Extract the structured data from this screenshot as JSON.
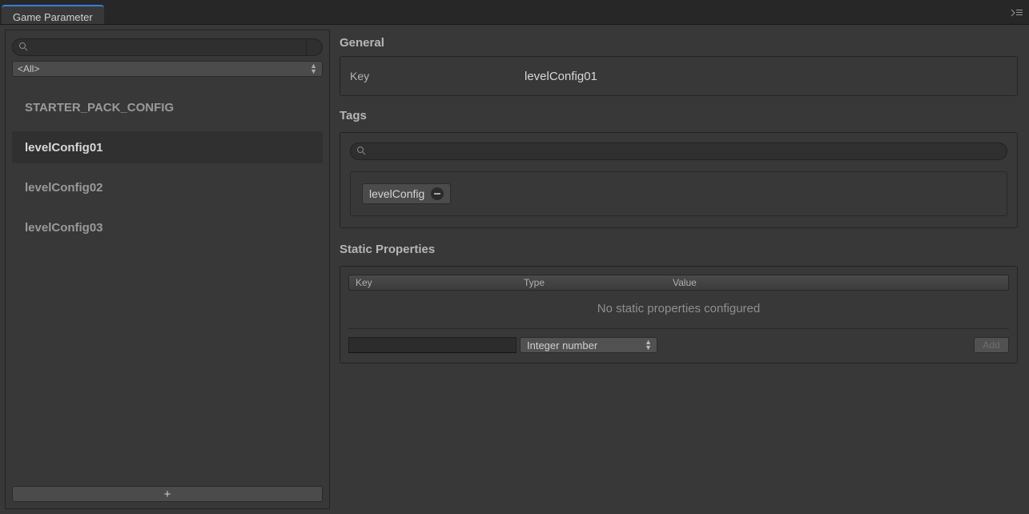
{
  "tab": {
    "title": "Game Parameter"
  },
  "sidebar": {
    "search": {
      "placeholder": ""
    },
    "filter": {
      "label": "<All>"
    },
    "items": [
      {
        "label": "STARTER_PACK_CONFIG",
        "selected": false
      },
      {
        "label": "levelConfig01",
        "selected": true
      },
      {
        "label": "levelConfig02",
        "selected": false
      },
      {
        "label": "levelConfig03",
        "selected": false
      }
    ],
    "add_label": "+"
  },
  "sections": {
    "general": {
      "title": "General",
      "key_label": "Key",
      "key_value": "levelConfig01"
    },
    "tags": {
      "title": "Tags",
      "search_placeholder": "",
      "items": [
        {
          "label": "levelConfig"
        }
      ]
    },
    "static_props": {
      "title": "Static Properties",
      "columns": {
        "key": "Key",
        "type": "Type",
        "value": "Value"
      },
      "empty": "No static properties configured",
      "new_type": "Integer number",
      "add_label": "Add"
    }
  }
}
